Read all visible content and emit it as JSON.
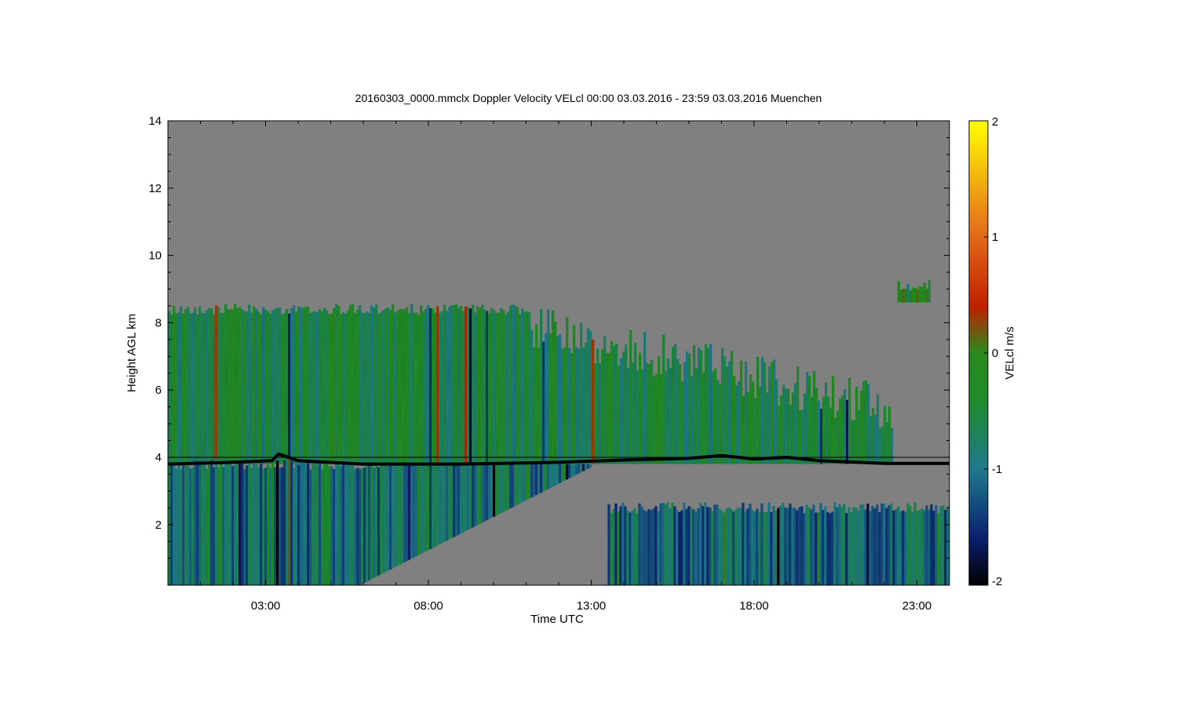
{
  "chart_data": {
    "type": "heatmap",
    "title": "20160303_0000.mmclx Doppler Velocity VELcl   00:00 03.03.2016 - 23:59 03.03.2016 Muenchen",
    "xlabel": "Time UTC",
    "ylabel": "Height AGL km",
    "colorbar_label": "VELcl m/s",
    "x_ticks": [
      "03:00",
      "08:00",
      "13:00",
      "18:00",
      "23:00"
    ],
    "y_ticks": [
      "2",
      "4",
      "6",
      "8",
      "10",
      "12",
      "14"
    ],
    "colorbar_ticks": [
      "-2",
      "-1",
      "0",
      "1",
      "2"
    ],
    "xlim_hours": [
      0,
      24
    ],
    "ylim_km": [
      0.2,
      14
    ],
    "clim": [
      -2,
      2
    ],
    "background_color": "#808080",
    "colormap": [
      "#000000",
      "#0a1f6e",
      "#1f7a8c",
      "#1e8c2a",
      "#2a8a1c",
      "#c02000",
      "#e8781a",
      "#ffff00"
    ],
    "echo_regions": [
      {
        "name": "upper-cloud",
        "time_start_h": 0.0,
        "time_end_h": 22.2,
        "height_top_km": 8.4,
        "height_bottom_km": 3.8,
        "mean_velocity": -0.4
      },
      {
        "name": "lower-precip-morning",
        "time_start_h": 0.0,
        "time_end_h": 13.0,
        "height_top_km": 3.8,
        "height_bottom_km": 0.2,
        "mean_velocity": -0.8
      },
      {
        "name": "boundary-layer-afternoon",
        "time_start_h": 13.5,
        "time_end_h": 24.0,
        "height_top_km": 2.5,
        "height_bottom_km": 0.2,
        "mean_velocity": -0.9
      },
      {
        "name": "isolated-cloud",
        "time_start_h": 22.4,
        "time_end_h": 23.4,
        "height_top_km": 9.1,
        "height_bottom_km": 8.6,
        "mean_velocity": 0.0
      }
    ],
    "melting_layer_height_km": [
      {
        "hour": 0,
        "height": 3.8
      },
      {
        "hour": 2,
        "height": 3.85
      },
      {
        "hour": 3.2,
        "height": 3.9
      },
      {
        "hour": 3.4,
        "height": 4.1
      },
      {
        "hour": 4,
        "height": 3.9
      },
      {
        "hour": 6,
        "height": 3.8
      },
      {
        "hour": 9,
        "height": 3.8
      },
      {
        "hour": 12,
        "height": 3.85
      },
      {
        "hour": 14,
        "height": 3.92
      },
      {
        "hour": 16,
        "height": 3.97
      },
      {
        "hour": 17,
        "height": 4.05
      },
      {
        "hour": 18,
        "height": 3.95
      },
      {
        "hour": 19,
        "height": 4.0
      },
      {
        "hour": 20,
        "height": 3.9
      },
      {
        "hour": 22,
        "height": 3.82
      },
      {
        "hour": 24,
        "height": 3.82
      }
    ],
    "reference_line_km": 4.0,
    "grid": false,
    "legend": "colorbar-right"
  }
}
